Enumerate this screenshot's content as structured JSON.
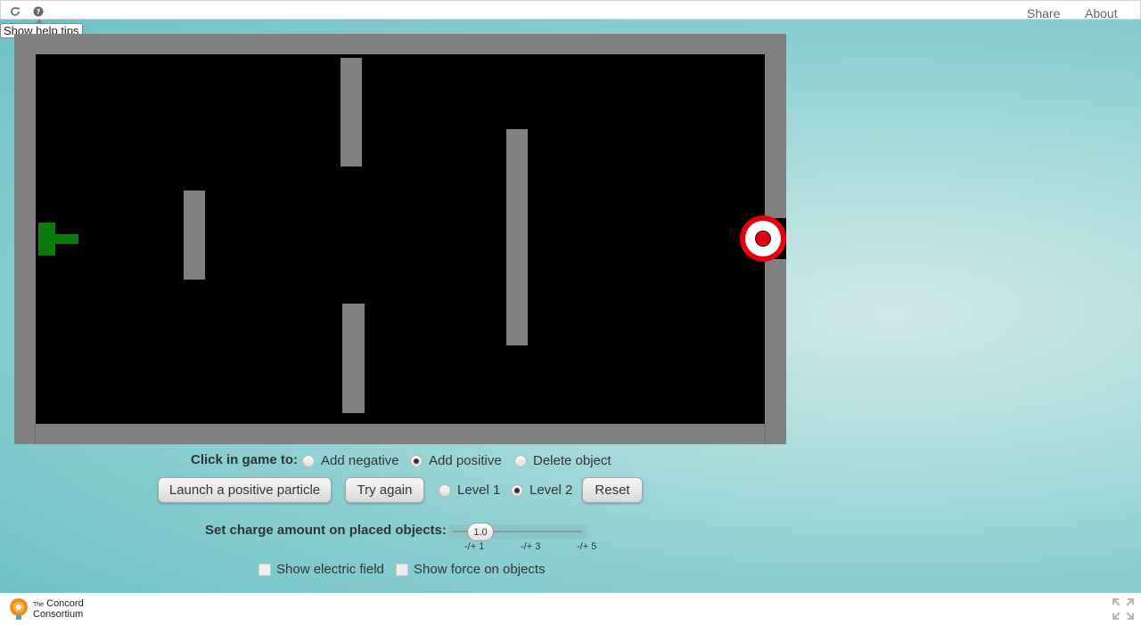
{
  "topbar": {
    "reload_icon": "reload-icon",
    "help_icon": "question-circle-icon",
    "share_label": "Share",
    "about_label": "About"
  },
  "tooltip": {
    "text": "Show help tips"
  },
  "game": {
    "field_color": "#000000",
    "wall_color": "#808080",
    "launcher_color": "#0a7a0a",
    "target_color": "#e6000e"
  },
  "controls": {
    "click_label": "Click in game to:",
    "mode_options": [
      {
        "label": "Add negative",
        "selected": false
      },
      {
        "label": "Add positive",
        "selected": true
      },
      {
        "label": "Delete object",
        "selected": false
      }
    ],
    "launch_label": "Launch a positive particle",
    "try_again_label": "Try again",
    "level_options": [
      {
        "label": "Level 1",
        "selected": false
      },
      {
        "label": "Level 2",
        "selected": true
      }
    ],
    "reset_label": "Reset",
    "charge_label": "Set charge amount on placed objects:",
    "slider": {
      "value": "1.0",
      "ticks": [
        "-/+ 1",
        "-/+ 3",
        "-/+ 5"
      ]
    },
    "show_field_label": "Show electric field",
    "show_force_label": "Show force on objects"
  },
  "footer": {
    "logo_small": "The",
    "logo_line1": "Concord",
    "logo_line2": "Consortium",
    "fullscreen_icon": "fullscreen-icon"
  }
}
